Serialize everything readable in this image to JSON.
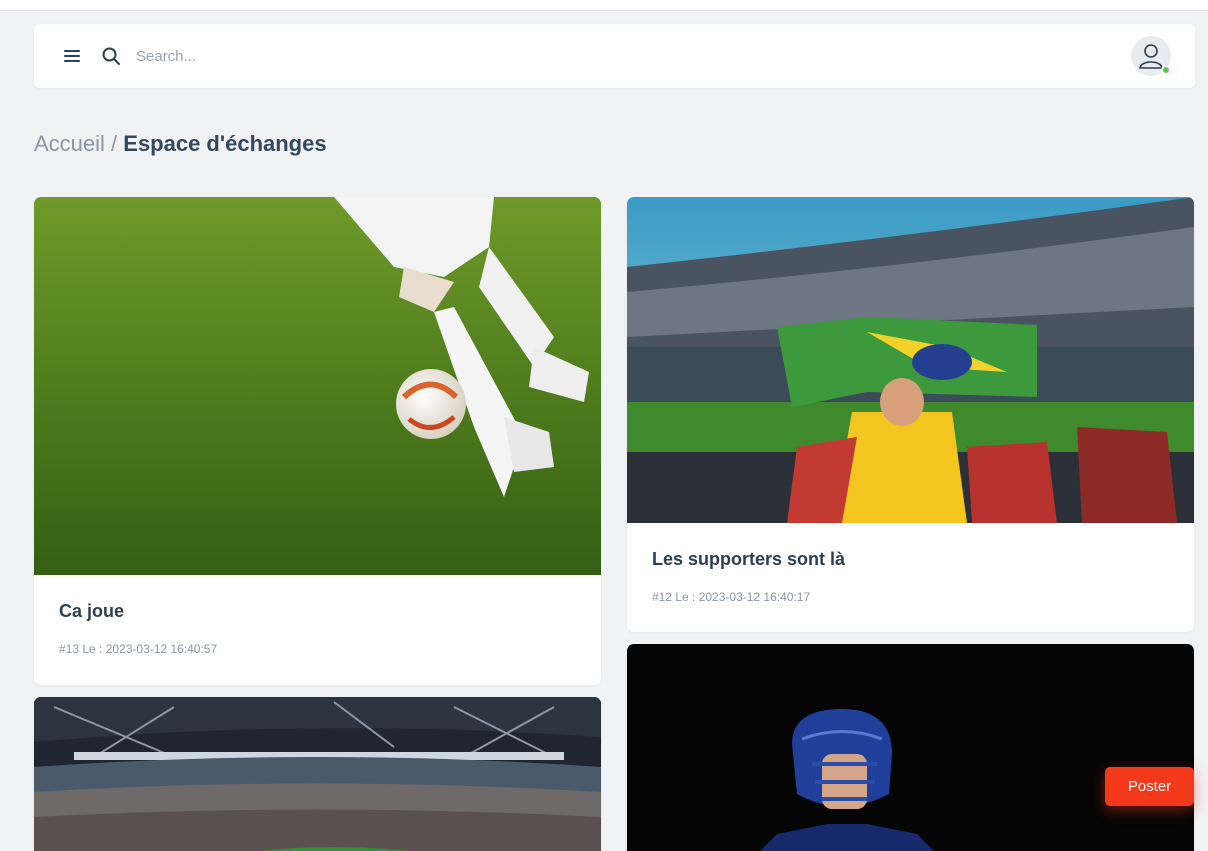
{
  "search": {
    "placeholder": "Search..."
  },
  "breadcrumb": {
    "home": "Accueil",
    "separator": " / ",
    "current": "Espace d'échanges"
  },
  "posts": [
    {
      "title": "Ca joue",
      "meta": "#13 Le : 2023-03-12 16:40:57",
      "image": "soccer-player-kicking-ball-photo"
    },
    {
      "title": "Les supporters sont là",
      "meta": "#12 Le : 2023-03-12 16:40:17",
      "image": "stadium-fan-with-flag-photo"
    },
    {
      "image": "stadium-at-night-photo"
    },
    {
      "image": "american-football-player-helmet-photo"
    }
  ],
  "actions": {
    "poster_label": "Poster"
  },
  "colors": {
    "accent": "#f4381a",
    "online": "#5cc452",
    "background": "#f1f2f4",
    "title": "#2c3e50"
  }
}
